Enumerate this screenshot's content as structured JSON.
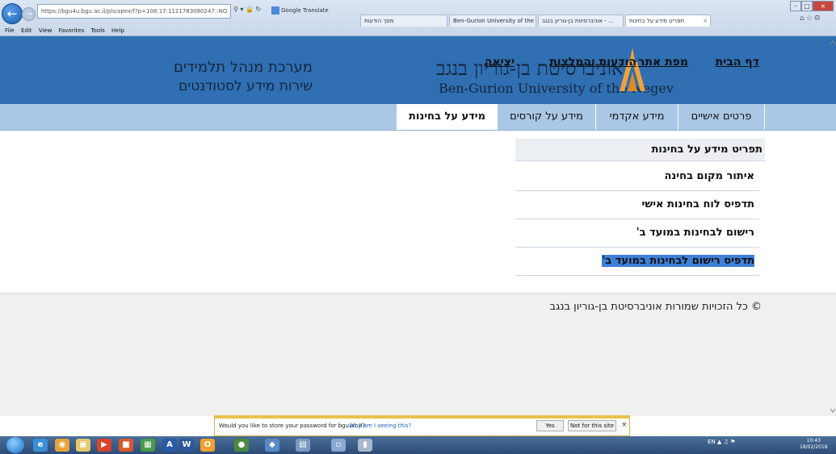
{
  "browser": {
    "address": "https://bgu4u.bgu.ac.il/pls/apex/f?p=108:17:1121783080247::NO",
    "address_host": "bgu4u.bgu.ac.il",
    "google_translate": "Google Translate",
    "tabs": [
      {
        "label": "מסך הודעות"
      },
      {
        "label": "Ben-Gurion University of the N..."
      },
      {
        "label": "אוניברסיטת בן-גוריון בנגב - ..."
      },
      {
        "label": "תפריט מידע על בחינות",
        "active": true
      }
    ],
    "menu": [
      "File",
      "Edit",
      "View",
      "Favorites",
      "Tools",
      "Help"
    ]
  },
  "header": {
    "system_title": "מערכת מנהל תלמידים",
    "system_subtitle": "שירות מידע לסטודנטים",
    "university_he": "אוניברסיטת בן-גוריון בנגב",
    "university_en": "Ben-Gurion University of the Negev",
    "links": {
      "home": "דף הבית",
      "sitemap": "מפת אתר",
      "messages": "הודעות והמלצות",
      "exit": "יציאה"
    }
  },
  "nav": {
    "tabs": [
      {
        "label": "פרטים אישיים"
      },
      {
        "label": "מידע אקדמי"
      },
      {
        "label": "מידע על קורסים"
      },
      {
        "label": "מידע על בחינות",
        "active": true
      }
    ]
  },
  "exam_menu": {
    "title": "תפריט מידע על בחינות",
    "items": [
      {
        "label": "איתור מקום בחינה"
      },
      {
        "label": "תדפיס לוח בחינות אישי"
      },
      {
        "label": "רישום לבחינות במועד ב'"
      },
      {
        "label": "תדפיס רישום לבחינות במועד ב'",
        "selected": true
      }
    ]
  },
  "footer": {
    "copyright": "© כל הזכויות שמורות אוניברסיטת בן-גוריון בנגב"
  },
  "password_bar": {
    "message": "Would you like to store your password for bgu.ac.il?",
    "why": "Why am I seeing this?",
    "yes": "Yes",
    "no": "Not for this site",
    "close": "×"
  },
  "taskbar": {
    "lang": "EN",
    "time": "10:43",
    "date": "18/02/2018"
  },
  "colors": {
    "header_bg": "#2f6fb2",
    "nav_bg": "#aac7e6",
    "selection": "#3e7fd8"
  }
}
